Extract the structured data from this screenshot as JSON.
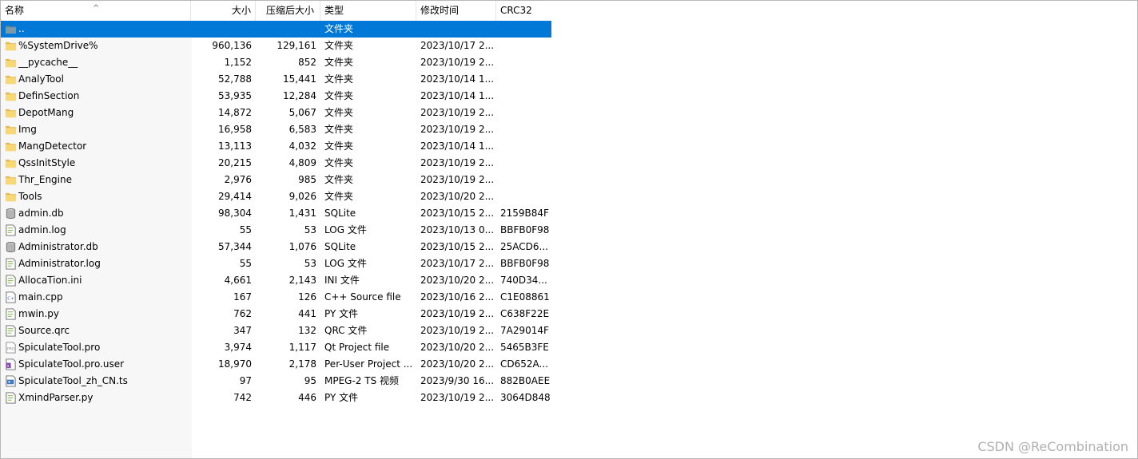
{
  "columns": {
    "name": "名称",
    "size": "大小",
    "packed": "压缩后大小",
    "type": "类型",
    "modified": "修改时间",
    "crc": "CRC32"
  },
  "rows": [
    {
      "name": "..",
      "size": "",
      "packed": "",
      "type": "文件夹",
      "modified": "",
      "crc": "",
      "icon": "parent-folder-icon",
      "selected": true
    },
    {
      "name": "%SystemDrive%",
      "size": "960,136",
      "packed": "129,161",
      "type": "文件夹",
      "modified": "2023/10/17 2...",
      "crc": "",
      "icon": "folder-icon"
    },
    {
      "name": "__pycache__",
      "size": "1,152",
      "packed": "852",
      "type": "文件夹",
      "modified": "2023/10/19 2...",
      "crc": "",
      "icon": "folder-icon"
    },
    {
      "name": "AnalyTool",
      "size": "52,788",
      "packed": "15,441",
      "type": "文件夹",
      "modified": "2023/10/14 1...",
      "crc": "",
      "icon": "folder-icon"
    },
    {
      "name": "DefinSection",
      "size": "53,935",
      "packed": "12,284",
      "type": "文件夹",
      "modified": "2023/10/14 1...",
      "crc": "",
      "icon": "folder-icon"
    },
    {
      "name": "DepotMang",
      "size": "14,872",
      "packed": "5,067",
      "type": "文件夹",
      "modified": "2023/10/19 2...",
      "crc": "",
      "icon": "folder-icon"
    },
    {
      "name": "Img",
      "size": "16,958",
      "packed": "6,583",
      "type": "文件夹",
      "modified": "2023/10/19 2...",
      "crc": "",
      "icon": "folder-icon"
    },
    {
      "name": "MangDetector",
      "size": "13,113",
      "packed": "4,032",
      "type": "文件夹",
      "modified": "2023/10/14 1...",
      "crc": "",
      "icon": "folder-icon"
    },
    {
      "name": "QssInitStyle",
      "size": "20,215",
      "packed": "4,809",
      "type": "文件夹",
      "modified": "2023/10/19 2...",
      "crc": "",
      "icon": "folder-icon"
    },
    {
      "name": "Thr_Engine",
      "size": "2,976",
      "packed": "985",
      "type": "文件夹",
      "modified": "2023/10/19 2...",
      "crc": "",
      "icon": "folder-icon"
    },
    {
      "name": "Tools",
      "size": "29,414",
      "packed": "9,026",
      "type": "文件夹",
      "modified": "2023/10/20 2...",
      "crc": "",
      "icon": "folder-icon"
    },
    {
      "name": "admin.db",
      "size": "98,304",
      "packed": "1,431",
      "type": "SQLite",
      "modified": "2023/10/15 2...",
      "crc": "2159B84F",
      "icon": "database-icon"
    },
    {
      "name": "admin.log",
      "size": "55",
      "packed": "53",
      "type": "LOG 文件",
      "modified": "2023/10/13 0...",
      "crc": "BBFB0F98",
      "icon": "text-file-icon"
    },
    {
      "name": "Administrator.db",
      "size": "57,344",
      "packed": "1,076",
      "type": "SQLite",
      "modified": "2023/10/15 2...",
      "crc": "25ACD6...",
      "icon": "database-icon"
    },
    {
      "name": "Administrator.log",
      "size": "55",
      "packed": "53",
      "type": "LOG 文件",
      "modified": "2023/10/17 2...",
      "crc": "BBFB0F98",
      "icon": "text-file-icon"
    },
    {
      "name": "AllocaTion.ini",
      "size": "4,661",
      "packed": "2,143",
      "type": "INI 文件",
      "modified": "2023/10/20 2...",
      "crc": "740D34...",
      "icon": "text-file-icon"
    },
    {
      "name": "main.cpp",
      "size": "167",
      "packed": "126",
      "type": "C++ Source file",
      "modified": "2023/10/16 2...",
      "crc": "C1E08861",
      "icon": "cpp-file-icon"
    },
    {
      "name": "mwin.py",
      "size": "762",
      "packed": "441",
      "type": "PY 文件",
      "modified": "2023/10/19 2...",
      "crc": "C638F22E",
      "icon": "text-file-icon"
    },
    {
      "name": "Source.qrc",
      "size": "347",
      "packed": "132",
      "type": "QRC 文件",
      "modified": "2023/10/19 2...",
      "crc": "7A29014F",
      "icon": "text-file-icon"
    },
    {
      "name": "SpiculateTool.pro",
      "size": "3,974",
      "packed": "1,117",
      "type": "Qt Project file",
      "modified": "2023/10/20 2...",
      "crc": "5465B3FE",
      "icon": "pro-file-icon"
    },
    {
      "name": "SpiculateTool.pro.user",
      "size": "18,970",
      "packed": "2,178",
      "type": "Per-User Project ...",
      "modified": "2023/10/20 2...",
      "crc": "CD652A...",
      "icon": "xml-file-icon"
    },
    {
      "name": "SpiculateTool_zh_CN.ts",
      "size": "97",
      "packed": "95",
      "type": "MPEG-2 TS 视频",
      "modified": "2023/9/30 16...",
      "crc": "882B0AEE",
      "icon": "ts-file-icon"
    },
    {
      "name": "XmindParser.py",
      "size": "742",
      "packed": "446",
      "type": "PY 文件",
      "modified": "2023/10/19 2...",
      "crc": "3064D848",
      "icon": "text-file-icon"
    }
  ],
  "watermark": "CSDN @ReCombination",
  "colors": {
    "selection": "#0078d7",
    "folder": "#f8d775",
    "folder_dark": "#e8b84a"
  }
}
